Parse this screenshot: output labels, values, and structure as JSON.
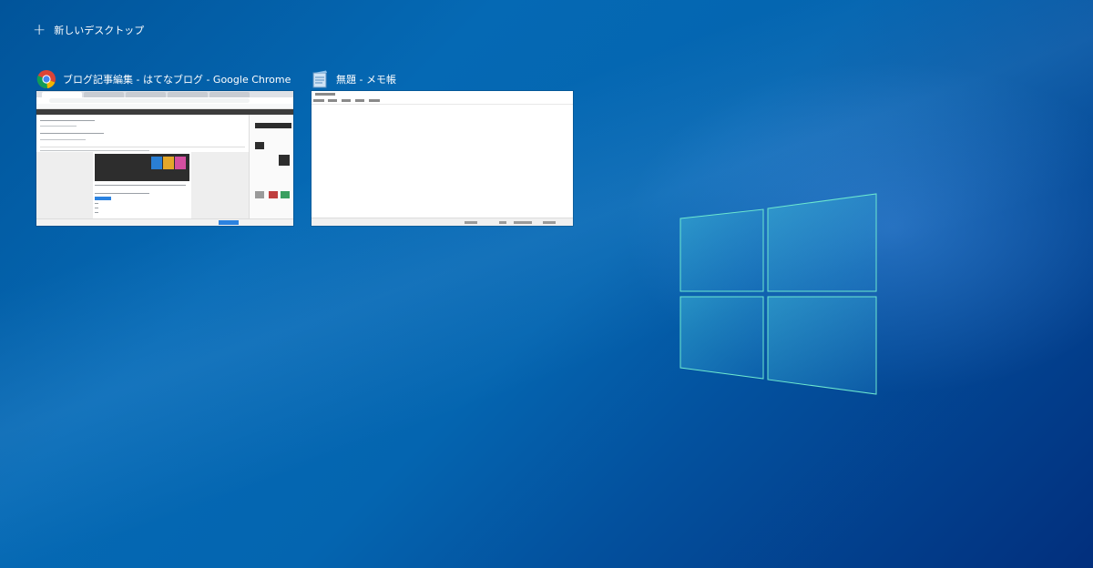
{
  "desktop": {
    "new_desktop_label": "新しいデスクトップ",
    "new_desktop_icon": "plus-icon"
  },
  "windows": [
    {
      "title": "ブログ記事編集 - はてなブログ - Google Chrome",
      "app_icon": "chrome-icon"
    },
    {
      "title": "無題 - メモ帳",
      "app_icon": "notepad-icon"
    }
  ],
  "colors": {
    "wallpaper_blue": "#0569b4",
    "logo_glow": "#5de6c8",
    "chrome_red": "#db4437",
    "chrome_green": "#0f9d58",
    "chrome_yellow": "#f4b400",
    "chrome_blue": "#4285f4"
  }
}
